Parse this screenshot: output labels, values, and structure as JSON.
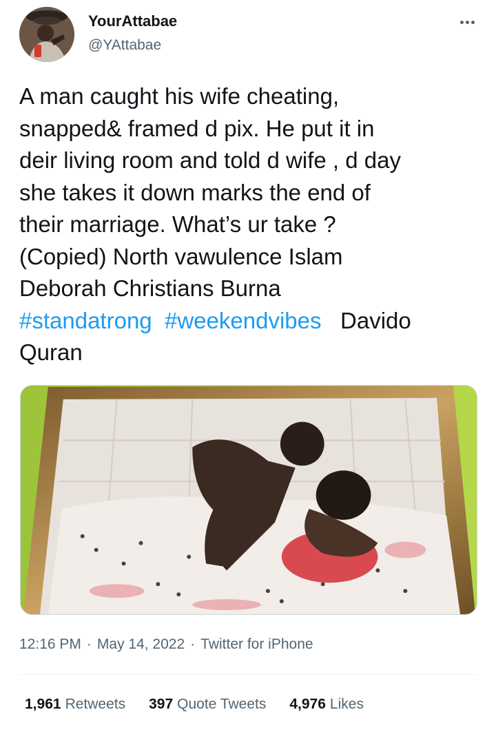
{
  "tweet": {
    "display_name": "YourAttabae",
    "handle": "@YAttabae",
    "text_lines": [
      "A man caught his wife cheating,",
      "snapped& framed d pix. He put it in",
      "deir living room and told d wife , d day",
      "she takes it down marks the end of",
      "their marriage. What’s ur take ?",
      "(Copied) North vawulence Islam",
      "Deborah Christians Burna"
    ],
    "hashtags": [
      "#standatrong",
      "#weekendvibes"
    ],
    "trailing_words_line": "Davido",
    "last_line": "Quran",
    "time": "12:16 PM",
    "separator": "·",
    "date": "May 14, 2022",
    "source": "Twitter for iPhone"
  },
  "stats": {
    "retweets_count": "1,961",
    "retweets_label": "Retweets",
    "quotes_count": "397",
    "quotes_label": "Quote Tweets",
    "likes_count": "4,976",
    "likes_label": "Likes"
  },
  "icons": {
    "more": "more-dots-icon"
  }
}
